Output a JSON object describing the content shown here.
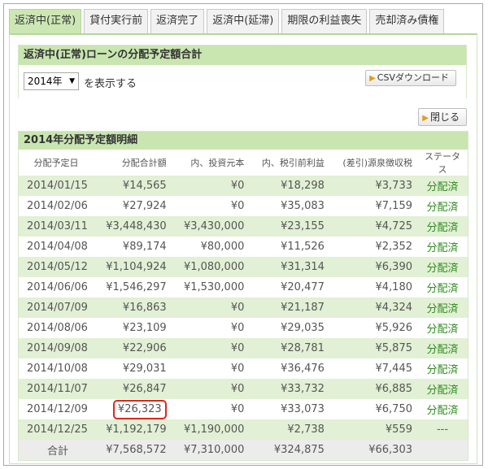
{
  "tabs": [
    {
      "label": "返済中(正常)",
      "active": true
    },
    {
      "label": "貸付実行前",
      "active": false
    },
    {
      "label": "返済完了",
      "active": false
    },
    {
      "label": "返済中(延滞)",
      "active": false
    },
    {
      "label": "期限の利益喪失",
      "active": false
    },
    {
      "label": "売却済み債権",
      "active": false
    }
  ],
  "summary": {
    "title": "返済中(正常)ローンの分配予定額合計",
    "year_value": "2014年",
    "year_suffix": "を表示する",
    "csv_label": "CSVダウンロード"
  },
  "close_label": "閉じる",
  "detail": {
    "title": "2014年分配予定額明細",
    "headers": [
      "分配予定日",
      "分配合計額",
      "内、投資元本",
      "内、税引前利益",
      "(差引)源泉徴収税",
      "ステータス"
    ],
    "rows": [
      [
        "2014/01/15",
        "¥14,565",
        "¥0",
        "¥18,298",
        "¥3,733",
        "分配済"
      ],
      [
        "2014/02/06",
        "¥27,924",
        "¥0",
        "¥35,083",
        "¥7,159",
        "分配済"
      ],
      [
        "2014/03/11",
        "¥3,448,430",
        "¥3,430,000",
        "¥23,155",
        "¥4,725",
        "分配済"
      ],
      [
        "2014/04/08",
        "¥89,174",
        "¥80,000",
        "¥11,526",
        "¥2,352",
        "分配済"
      ],
      [
        "2014/05/12",
        "¥1,104,924",
        "¥1,080,000",
        "¥31,314",
        "¥6,390",
        "分配済"
      ],
      [
        "2014/06/06",
        "¥1,546,297",
        "¥1,530,000",
        "¥20,477",
        "¥4,180",
        "分配済"
      ],
      [
        "2014/07/09",
        "¥16,863",
        "¥0",
        "¥21,187",
        "¥4,324",
        "分配済"
      ],
      [
        "2014/08/06",
        "¥23,109",
        "¥0",
        "¥29,035",
        "¥5,926",
        "分配済"
      ],
      [
        "2014/09/08",
        "¥22,906",
        "¥0",
        "¥28,781",
        "¥5,875",
        "分配済"
      ],
      [
        "2014/10/08",
        "¥29,031",
        "¥0",
        "¥36,476",
        "¥7,445",
        "分配済"
      ],
      [
        "2014/11/07",
        "¥26,847",
        "¥0",
        "¥33,732",
        "¥6,885",
        "分配済"
      ],
      [
        "2014/12/09",
        "¥26,323",
        "¥0",
        "¥33,073",
        "¥6,750",
        "分配済"
      ],
      [
        "2014/12/25",
        "¥1,192,179",
        "¥1,190,000",
        "¥2,738",
        "¥559",
        "---"
      ]
    ],
    "highlight_row": 11,
    "total": [
      "合計",
      "¥7,568,572",
      "¥7,310,000",
      "¥324,875",
      "¥66,303",
      ""
    ]
  },
  "colors": {
    "tab_active": "#cce7b4",
    "header_green": "#c9e5b0",
    "row_stripe": "#e2f0d5",
    "status_green": "#2e8b1f",
    "highlight_red": "#e0261e"
  }
}
